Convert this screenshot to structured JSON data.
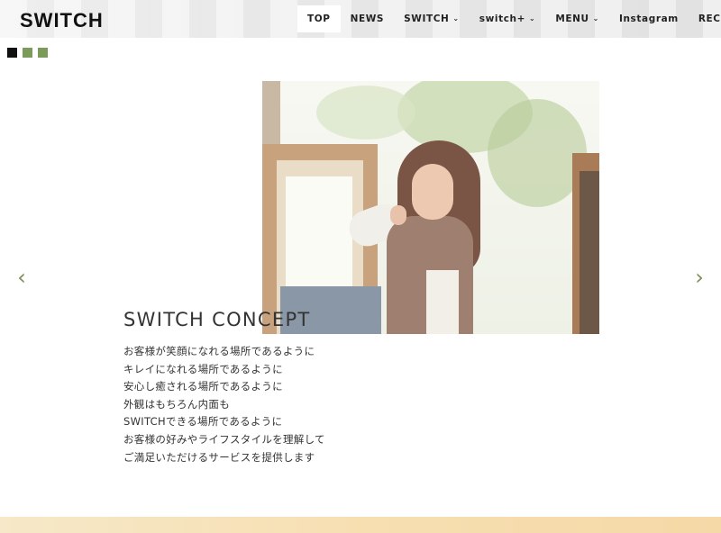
{
  "header": {
    "logo": "SWITCH",
    "nav": [
      {
        "label": "TOP",
        "has_dropdown": false,
        "active": true
      },
      {
        "label": "NEWS",
        "has_dropdown": false,
        "active": false
      },
      {
        "label": "SWITCH",
        "has_dropdown": true,
        "active": false
      },
      {
        "label": "switch+",
        "has_dropdown": true,
        "active": false
      },
      {
        "label": "MENU",
        "has_dropdown": true,
        "active": false
      },
      {
        "label": "Instagram",
        "has_dropdown": false,
        "active": false
      },
      {
        "label": "RECRUIT",
        "has_dropdown": false,
        "active": false
      }
    ],
    "chevron_glyph": "⌄"
  },
  "slider": {
    "indicators": [
      {
        "color": "#111111",
        "active": true
      },
      {
        "color": "#7c9a5a",
        "active": false
      },
      {
        "color": "#7c9a5a",
        "active": false
      }
    ],
    "prev_icon": "chevron-left-icon",
    "next_icon": "chevron-right-icon",
    "prev_glyph": "‹",
    "next_glyph": "›",
    "arrow_color": "#7c8f55"
  },
  "concept": {
    "title": "SWITCH CONCEPT",
    "lines": [
      "お客様が笑顔になれる場所であるように",
      "キレイになれる場所であるように",
      "安心し癒される場所であるように",
      "外観はもちろん内面も",
      "SWITCHできる場所であるように",
      "お客様の好みやライフスタイルを理解して",
      "ご満足いただけるサービスを提供します"
    ]
  }
}
